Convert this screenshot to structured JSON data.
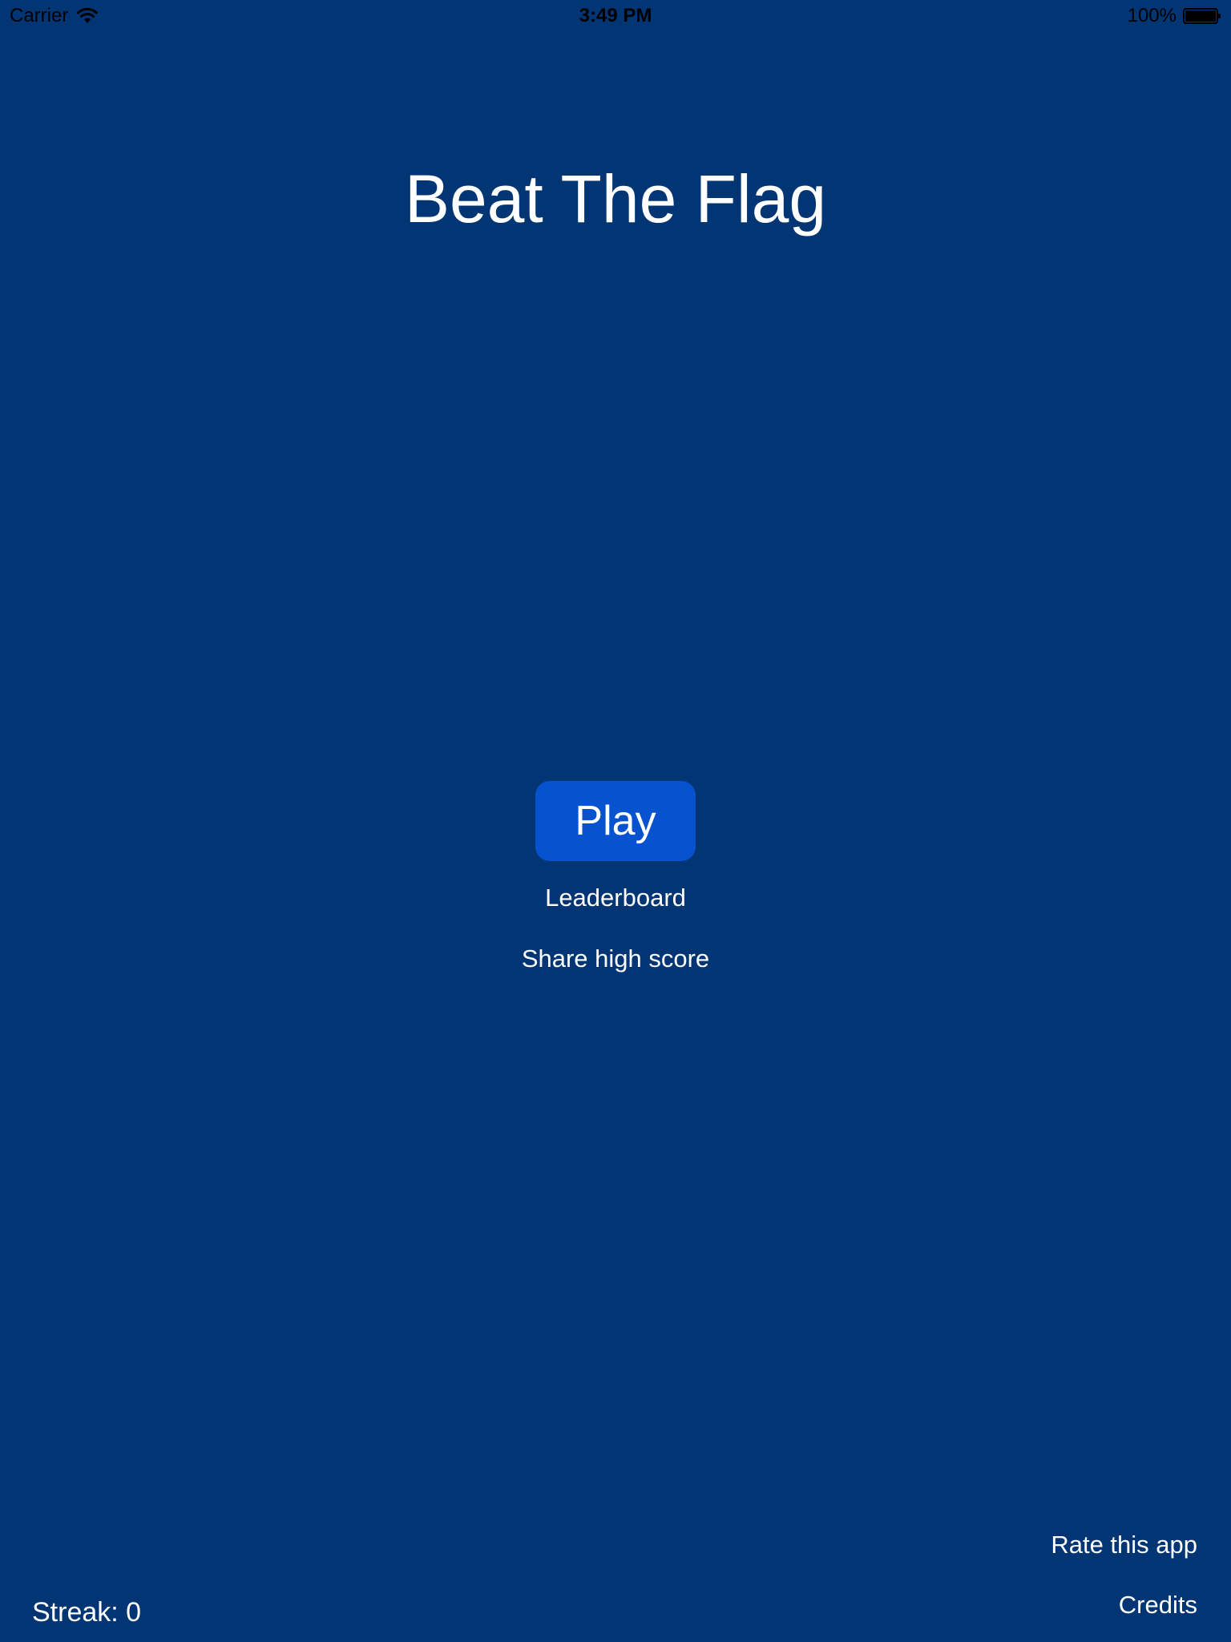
{
  "status_bar": {
    "carrier": "Carrier",
    "time": "3:49 PM",
    "battery_percent": "100%",
    "battery_level": 1.0,
    "icons": {
      "wifi": "wifi-icon",
      "battery": "battery-icon"
    }
  },
  "main": {
    "title": "Beat The Flag",
    "play_label": "Play",
    "leaderboard_label": "Leaderboard",
    "share_label": "Share high score"
  },
  "footer": {
    "rate_label": "Rate this app",
    "credits_label": "Credits",
    "streak_label": "Streak: 0"
  },
  "colors": {
    "background": "#013574",
    "play_button": "#0753cf",
    "text": "#ffffff",
    "status_text": "#000000"
  }
}
